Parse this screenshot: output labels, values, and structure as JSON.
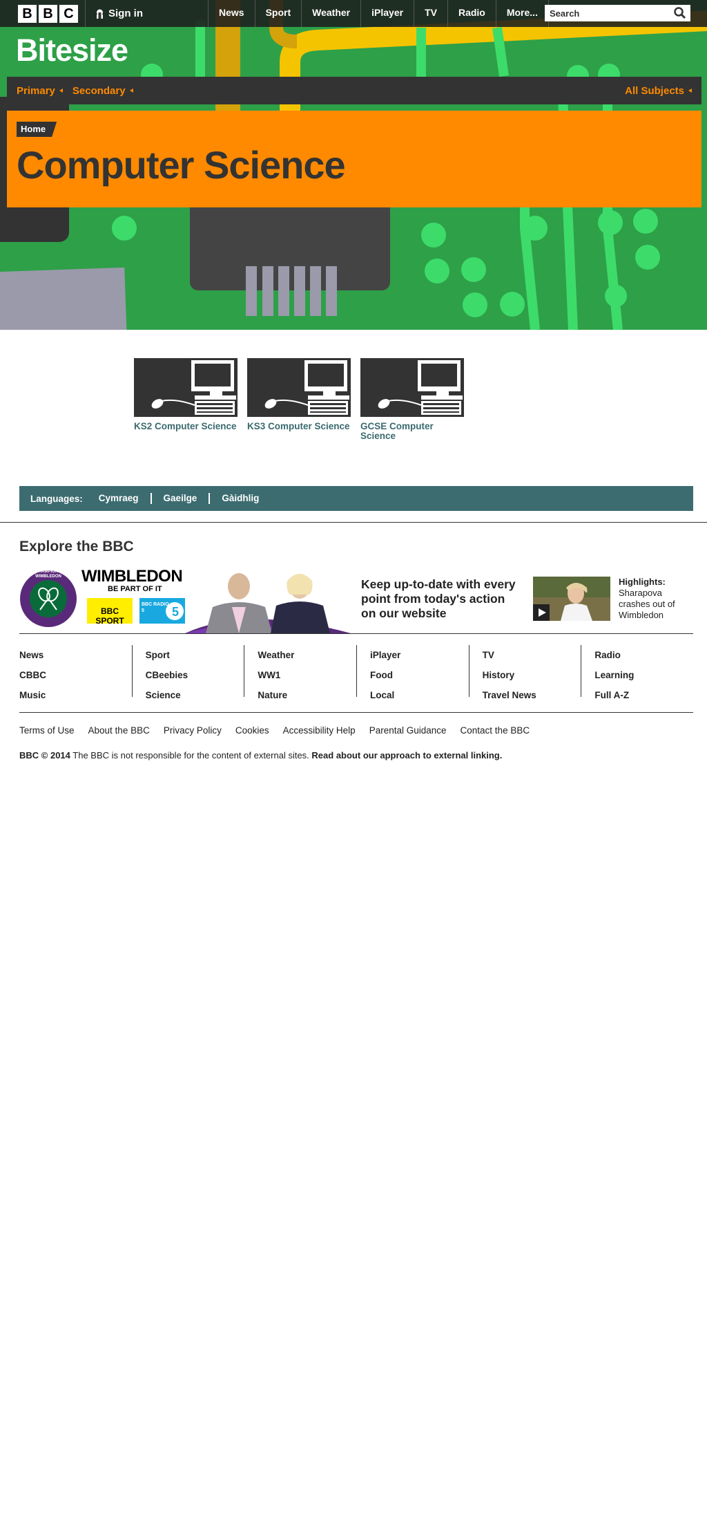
{
  "topbar": {
    "logo_letters": [
      "B",
      "B",
      "C"
    ],
    "signin_label": "Sign in",
    "nav": [
      "News",
      "Sport",
      "Weather",
      "iPlayer",
      "TV",
      "Radio",
      "More..."
    ],
    "search_placeholder": "Search"
  },
  "hero": {
    "brand": "Bitesize",
    "subnav": {
      "primary": "Primary",
      "secondary": "Secondary",
      "all_subjects": "All Subjects"
    },
    "breadcrumb": "Home",
    "title": "Computer Science",
    "colors": {
      "accent": "#ff8a00",
      "background": "#2ea048",
      "dark": "#333333"
    }
  },
  "topics": [
    {
      "label": "KS2 Computer Science",
      "icon": "computer-icon"
    },
    {
      "label": "KS3 Computer Science",
      "icon": "computer-icon"
    },
    {
      "label": "GCSE Computer Science",
      "icon": "computer-icon"
    }
  ],
  "languages": {
    "label": "Languages:",
    "items": [
      "Cymraeg",
      "Gaeilge",
      "Gàidhlig"
    ],
    "color": "#3c6c70"
  },
  "explore": {
    "title": "Explore the BBC",
    "promo": {
      "badge_ring_text": "THE CHAMPIONSHIPS WIMBLEDON",
      "wimbledon": "WIMBLEDON",
      "tagline": "BE PART OF IT",
      "sport_logo": "BBC SPORT",
      "radio_logo": "BBC RADIO 5",
      "headline": "Keep up-to-date with every point from today's action on our website",
      "highlight_label": "Highlights:",
      "highlight_text": "Sharapova crashes out of Wimbledon"
    }
  },
  "footer": {
    "columns": [
      [
        "News",
        "CBBC",
        "Music"
      ],
      [
        "Sport",
        "CBeebies",
        "Science"
      ],
      [
        "Weather",
        "WW1",
        "Nature"
      ],
      [
        "iPlayer",
        "Food",
        "Local"
      ],
      [
        "TV",
        "History",
        "Travel News"
      ],
      [
        "Radio",
        "Learning",
        "Full A-Z"
      ]
    ],
    "links": [
      "Terms of Use",
      "About the BBC",
      "Privacy Policy",
      "Cookies",
      "Accessibility Help",
      "Parental Guidance",
      "Contact the BBC"
    ],
    "copyright": "BBC © 2014",
    "disclaimer": "The BBC is not responsible for the content of external sites.",
    "external_link": "Read about our approach to external linking."
  }
}
